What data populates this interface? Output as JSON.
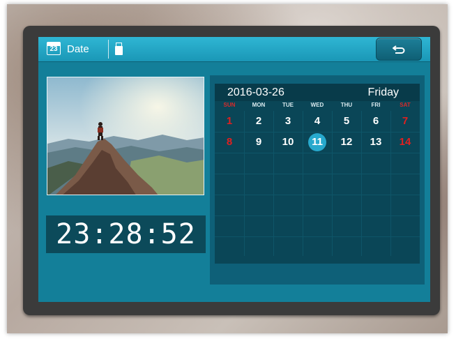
{
  "header": {
    "calendar_icon_day": "23",
    "title": "Date",
    "icons": [
      "calendar-icon",
      "usb-icon",
      "back-arrow-icon"
    ]
  },
  "clock": {
    "time": "23:28:52"
  },
  "calendar": {
    "date": "2016-03-26",
    "weekday": "Friday",
    "weekdays": [
      "SUN",
      "MON",
      "TUE",
      "WED",
      "THU",
      "FRI",
      "SAT"
    ],
    "weeks": [
      [
        "1",
        "2",
        "3",
        "4",
        "5",
        "6",
        "7"
      ],
      [
        "8",
        "9",
        "10",
        "11",
        "12",
        "13",
        "14"
      ]
    ],
    "highlighted_day": "11",
    "weekend_color": "#e02020",
    "highlight_color": "#27a9cd"
  },
  "colors": {
    "screen_bg": "#137f99",
    "topbar": "#2fb6d4",
    "panel_bg": "#0a4657"
  }
}
